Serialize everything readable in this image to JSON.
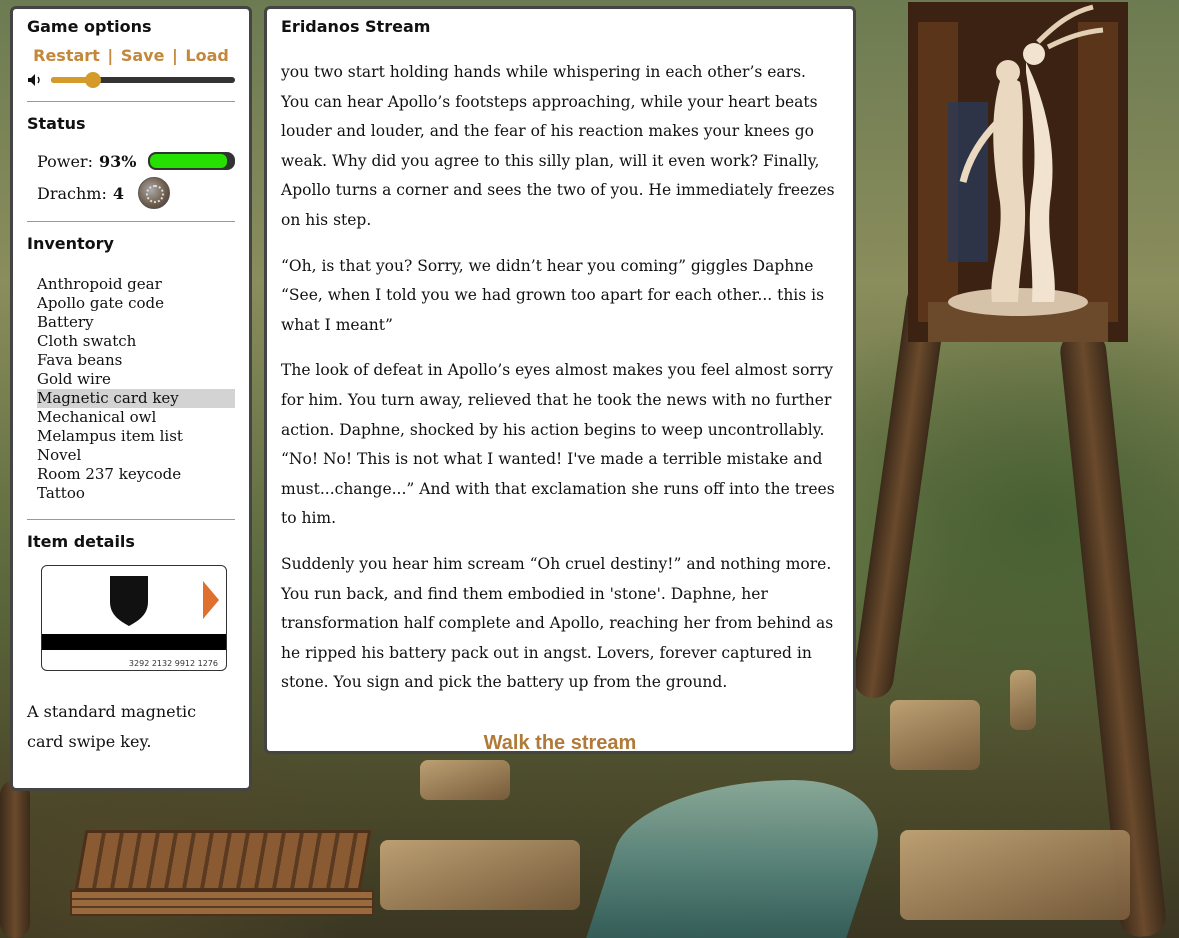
{
  "sidebar": {
    "game_options_heading": "Game options",
    "links": {
      "restart": "Restart",
      "save": "Save",
      "load": "Load",
      "separator": "|"
    },
    "volume": 0.23,
    "status_heading": "Status",
    "power_label": "Power:",
    "power_value": "93%",
    "power_fraction": 0.93,
    "drachm_label": "Drachm:",
    "drachm_value": "4",
    "inventory_heading": "Inventory",
    "inventory": [
      "Anthropoid gear",
      "Apollo gate code",
      "Battery",
      "Cloth swatch",
      "Fava beans",
      "Gold wire",
      "Magnetic card key",
      "Mechanical owl",
      "Melampus item list",
      "Novel",
      "Room 237 keycode",
      "Tattoo"
    ],
    "selected_item": "Magnetic card key",
    "item_details_heading": "Item details",
    "card_number": "3292 2132 9912 1276",
    "item_description": "A standard magnetic card swipe key."
  },
  "main": {
    "title": "Eridanos Stream",
    "paragraphs": [
      "you two start holding hands while whispering in each other’s ears. You can hear Apollo’s footsteps approaching, while your heart beats louder and louder, and the fear of his reaction makes your knees go weak. Why did you agree to this silly plan, will it even work? Finally, Apollo turns a corner and sees the two of you. He immediately freezes on his step.",
      "“Oh, is that you? Sorry, we didn’t hear you coming” giggles Daphne “See, when I told you we had grown too apart for each other... this is what I meant”",
      "The look of defeat in Apollo’s eyes almost makes you feel almost sorry for him. You turn away, relieved that he took the news with no further action. Daphne, shocked by his action begins to weep uncontrollably. “No! No! This is not what I wanted! I've made a terrible mistake and must...change...” And with that exclamation she runs off into the trees to him.",
      "Suddenly you hear him scream “Oh cruel destiny!” and nothing more. You run back, and find them embodied in 'stone'. Daphne, her transformation half complete and Apollo, reaching her from behind as he ripped his battery pack out in angst. Lovers, forever captured in stone. You sign and pick the battery up from the ground."
    ],
    "action_link": "Walk the stream"
  },
  "colors": {
    "link": "#c4883a",
    "power_fill": "#25e000",
    "slider": "#d49a2a",
    "card_arrow": "#e07030"
  },
  "icons": {
    "speaker": "speaker-icon",
    "coin": "drachm-coin-icon",
    "shield": "shield-icon",
    "arrow": "arrow-right-icon"
  }
}
